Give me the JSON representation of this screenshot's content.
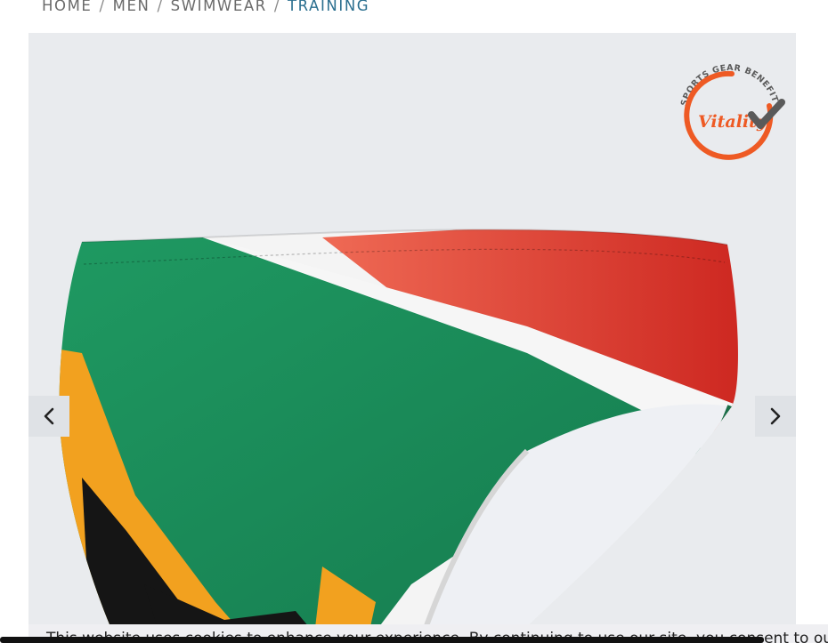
{
  "breadcrumb": {
    "items": [
      {
        "label": "HOME"
      },
      {
        "label": "MEN"
      },
      {
        "label": "SWIMWEAR"
      },
      {
        "label": "TRAINING"
      }
    ],
    "separator": "/"
  },
  "badge": {
    "arc_text": "SPORTS GEAR BENEFIT",
    "wordmark": "Vitality",
    "accent": "#ee5a24",
    "gray": "#5a5a5a"
  },
  "gallery": {
    "prev_icon": "chevron-left-icon",
    "next_icon": "chevron-right-icon",
    "product_colors": {
      "green": "#1b8a58",
      "white": "#f3f3f3",
      "red": "#e03a2c",
      "yellow": "#f2a11f",
      "black": "#151515"
    }
  },
  "cookie": {
    "text": "This website uses cookies to enhance your experience. By continuing to use our site, you consent to our use of cookies."
  }
}
